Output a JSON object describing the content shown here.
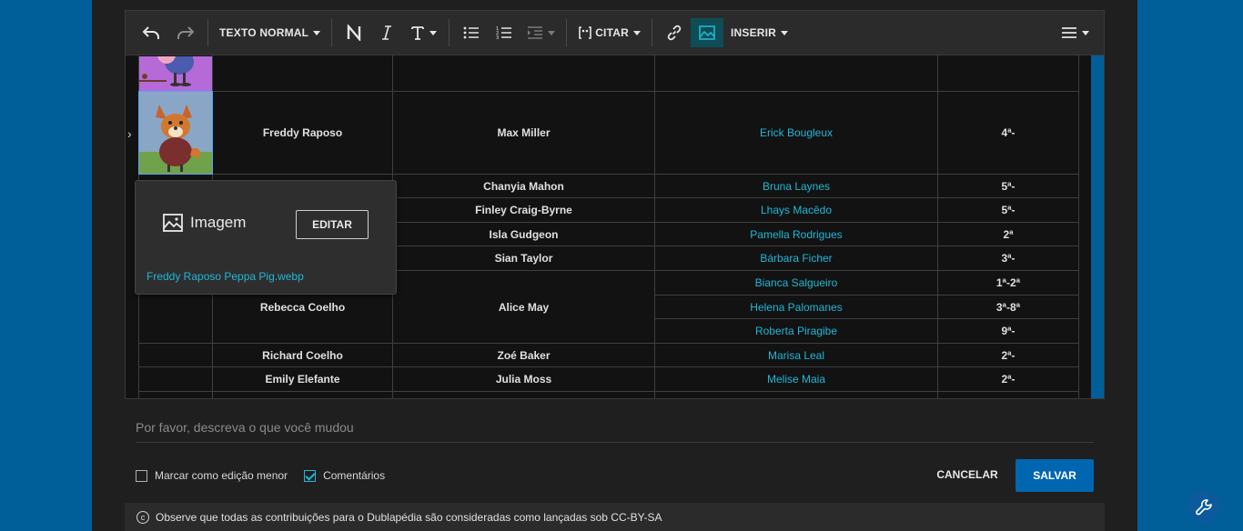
{
  "toolbar": {
    "paragraph_format": "TEXTO NORMAL",
    "cite_label": "CITAR",
    "insert_label": "INSERIR"
  },
  "table": {
    "rows": [
      {
        "character": "Freddy Raposo",
        "original": "Max Miller",
        "dubber": "Erick Bougleux",
        "season": "4ª-"
      },
      {
        "character": "",
        "original": "Chanyia Mahon",
        "dubber": "Bruna Laynes",
        "season": "5ª-"
      },
      {
        "character": "",
        "original": "Finley Craig-Byrne",
        "dubber": "Lhays Macêdo",
        "season": "5ª-"
      },
      {
        "character": "",
        "original": "Isla Gudgeon",
        "dubber": "Pamella Rodrigues",
        "season": "2ª"
      },
      {
        "character": "",
        "original": "Sian Taylor",
        "dubber": "Bárbara Ficher",
        "season": "3ª-"
      },
      {
        "character": "Rebecca Coelho",
        "original": "Alice May",
        "dubbers": [
          {
            "dubber": "Bianca Salgueiro",
            "season": "1ª-2ª"
          },
          {
            "dubber": "Helena Palomanes",
            "season": "3ª-8ª"
          },
          {
            "dubber": "Roberta Piragibe",
            "season": "9ª-"
          }
        ]
      },
      {
        "character": "Richard Coelho",
        "original": "Zoé Baker",
        "dubber": "Marisa Leal",
        "season": "2ª-"
      },
      {
        "character": "Emily Elefante",
        "original": "Julia Moss",
        "dubber": "Melise Maia",
        "season": "2ª-"
      }
    ]
  },
  "popup": {
    "title": "Imagem",
    "edit_label": "EDITAR",
    "filename": "Freddy Raposo Peppa Pig.webp"
  },
  "summary": {
    "placeholder": "Por favor, descreva o que você mudou"
  },
  "options": {
    "minor_edit": "Marcar como edição menor",
    "comments": "Comentários",
    "minor_edit_checked": false,
    "comments_checked": true
  },
  "actions": {
    "cancel": "CANCELAR",
    "save": "SALVAR"
  },
  "license": {
    "text": "Observe que todas as contribuições para o Dublapédia são consideradas como lançadas sob CC-BY-SA"
  },
  "colors": {
    "accent": "#1fb8d8",
    "primary_button": "#0066b0",
    "background": "#1f1f1f",
    "side_background": "#005f99"
  }
}
